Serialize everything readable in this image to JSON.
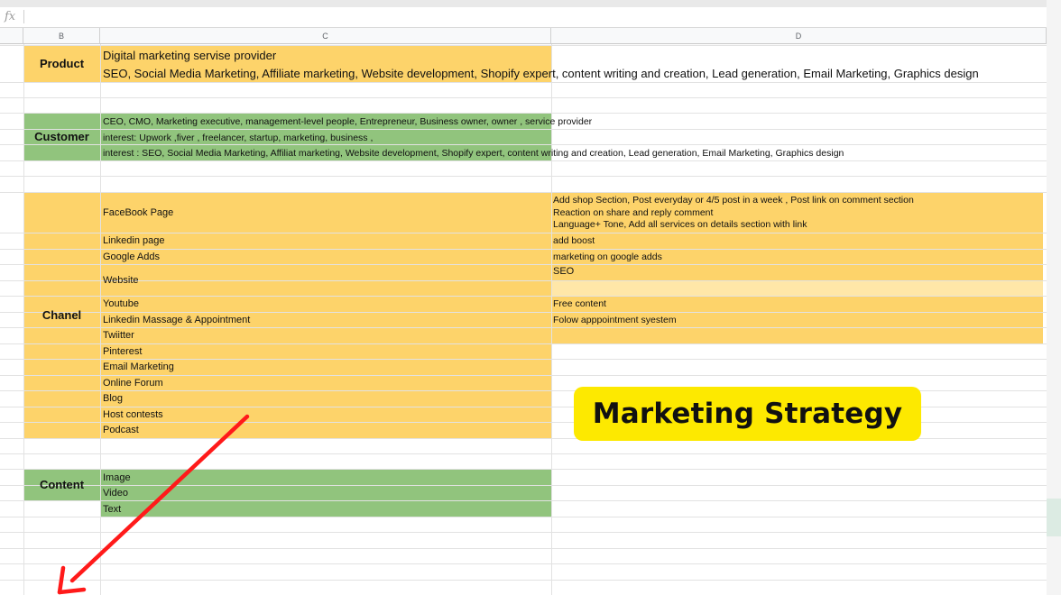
{
  "formula_bar": {
    "fx": "fx"
  },
  "columns": [
    "B",
    "C",
    "D"
  ],
  "sections": {
    "product": {
      "label": "Product",
      "line1": "Digital marketing servise provider",
      "line2": "SEO, Social Media Marketing, Affiliate marketing, Website development, Shopify expert, content writing and creation, Lead generation, Email Marketing, Graphics design"
    },
    "customer": {
      "label": "Customer",
      "lines": [
        "CEO, CMO, Marketing executive, management-level people, Entrepreneur, Business owner, owner , service provider",
        "interest: Upwork ,fiver , freelancer, startup, marketing, business ,",
        "interest : SEO, Social Media Marketing, Affiliat marketing, Website development, Shopify expert, content writing and creation, Lead generation, Email Marketing, Graphics design"
      ]
    },
    "chanel": {
      "label": "Chanel",
      "items": [
        "FaceBook Page",
        "Linkedin page",
        "Google Adds",
        "Website",
        "Youtube",
        "Linkedin Massage & Appointment",
        "Twiitter",
        "Pinterest",
        "Email Marketing",
        "Online Forum",
        "Blog",
        "Host contests",
        "Podcast"
      ],
      "notes": {
        "facebook": [
          "Add shop Section, Post everyday or 4/5 post in a week , Post link on comment section",
          "Reaction on share and reply comment",
          "Language+ Tone, Add all services on details section with link"
        ],
        "linkedin": "add boost",
        "google": "marketing on google adds",
        "website": "SEO",
        "youtube": "Free content",
        "linkedin_massage": "Folow apppointment syestem"
      }
    },
    "content": {
      "label": "Content",
      "items": [
        "Image",
        "Video",
        "Text"
      ]
    }
  },
  "badge": {
    "title": "Marketing Strategy"
  },
  "colors": {
    "yellow": "#fdd36a",
    "green": "#91c47d",
    "badge": "#fde900",
    "arrow": "#ff1a1a"
  }
}
